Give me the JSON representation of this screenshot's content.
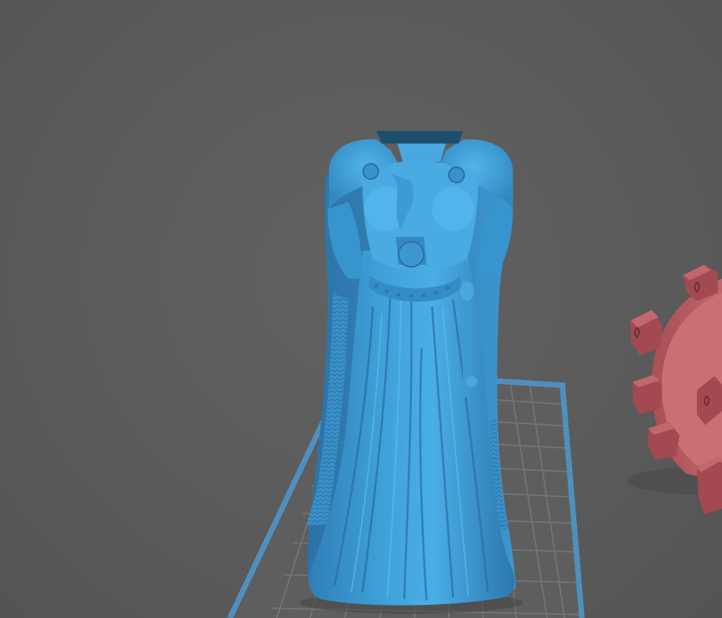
{
  "viewer": {
    "background_color": "#5b5b5b",
    "build_plate": {
      "border_color": "#4f8fbf",
      "grid_color": "#747474",
      "fill_color": "#5e5e5e"
    },
    "models": [
      {
        "name": "robed-figure-model",
        "color": "#3e9ad4",
        "selected": true
      },
      {
        "name": "round-base-model",
        "color": "#b35a5e",
        "selected": false
      }
    ]
  }
}
